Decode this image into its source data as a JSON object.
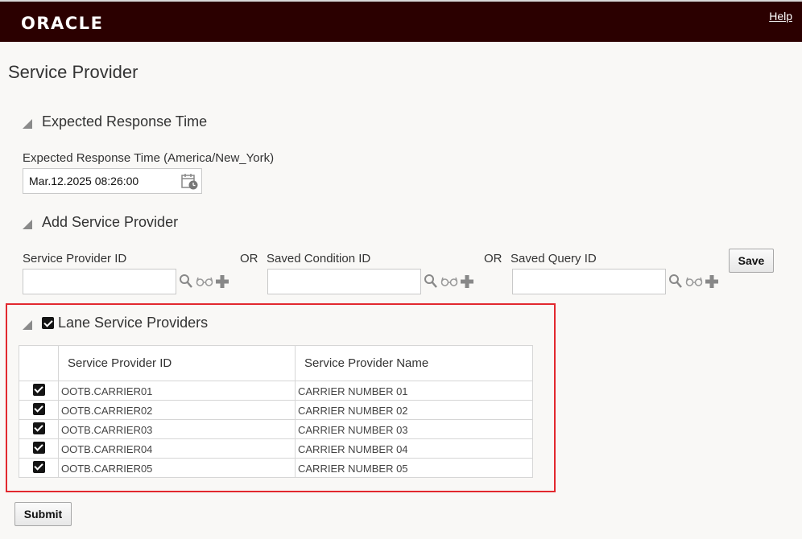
{
  "header": {
    "logo": "ORACLE",
    "help_link": "Help"
  },
  "page": {
    "title": "Service Provider"
  },
  "expected_response": {
    "section_title": "Expected Response Time",
    "field_label": "Expected Response Time (America/New_York)",
    "value": "Mar.12.2025 08:26:00"
  },
  "add_provider": {
    "section_title": "Add Service Provider",
    "provider_id_label": "Service Provider ID",
    "or_1": "OR",
    "condition_id_label": "Saved Condition ID",
    "or_2": "OR",
    "query_id_label": "Saved Query ID",
    "save_label": "Save"
  },
  "lane": {
    "section_title": "Lane Service Providers",
    "columns": [
      "Service Provider ID",
      "Service Provider Name"
    ],
    "rows": [
      {
        "id": "OOTB.CARRIER01",
        "name": "CARRIER NUMBER 01"
      },
      {
        "id": "OOTB.CARRIER02",
        "name": "CARRIER NUMBER 02"
      },
      {
        "id": "OOTB.CARRIER03",
        "name": "CARRIER NUMBER 03"
      },
      {
        "id": "OOTB.CARRIER04",
        "name": "CARRIER NUMBER 04"
      },
      {
        "id": "OOTB.CARRIER05",
        "name": "CARRIER NUMBER 05"
      }
    ]
  },
  "footer": {
    "submit_label": "Submit"
  }
}
